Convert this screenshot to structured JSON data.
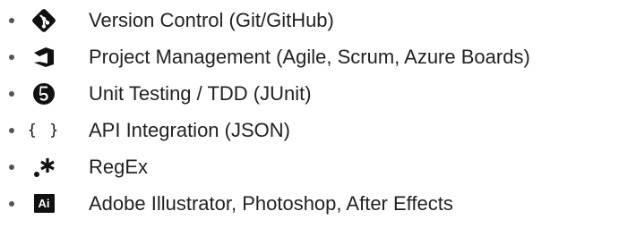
{
  "colors": {
    "text": "#222222",
    "icon": "#111111",
    "bullet": "#555555"
  },
  "skills": [
    {
      "icon": "git-icon",
      "label": "Version Control (Git/GitHub)"
    },
    {
      "icon": "azure-devops-icon",
      "label": "Project Management (Agile, Scrum, Azure Boards)"
    },
    {
      "icon": "junit5-icon",
      "label": "Unit Testing / TDD (JUnit)"
    },
    {
      "icon": "json-braces-icon",
      "label": "API Integration (JSON)",
      "glyph": "{ }"
    },
    {
      "icon": "regex-icon",
      "label": "RegEx"
    },
    {
      "icon": "adobe-illustrator-icon",
      "label": "Adobe Illustrator, Photoshop, After Effects",
      "glyph": "Ai"
    }
  ]
}
